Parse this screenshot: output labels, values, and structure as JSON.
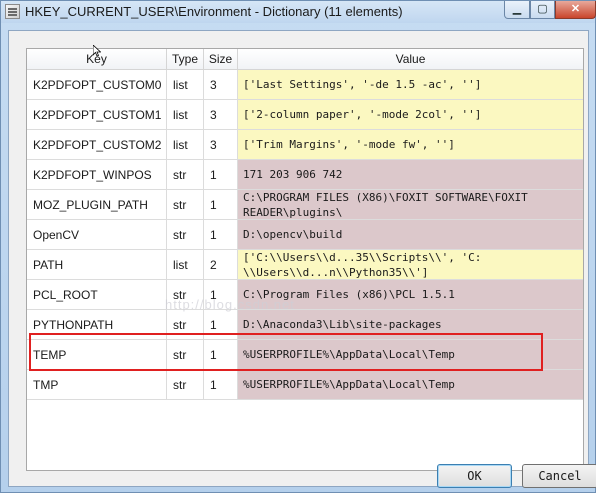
{
  "window": {
    "title": "HKEY_CURRENT_USER\\Environment - Dictionary (11 elements)",
    "minimize_glyph": "▁",
    "maximize_glyph": "▢",
    "close_glyph": "✕"
  },
  "table": {
    "columns": [
      "Key",
      "Type",
      "Size",
      "Value"
    ],
    "rows": [
      {
        "key": "K2PDFOPT_CUSTOM0",
        "type": "list",
        "size": "3",
        "value": "['Last Settings', '-de 1.5 -ac', '']"
      },
      {
        "key": "K2PDFOPT_CUSTOM1",
        "type": "list",
        "size": "3",
        "value": "['2-column paper', '-mode 2col', '']"
      },
      {
        "key": "K2PDFOPT_CUSTOM2",
        "type": "list",
        "size": "3",
        "value": "['Trim Margins', '-mode fw', '']"
      },
      {
        "key": "K2PDFOPT_WINPOS",
        "type": "str",
        "size": "1",
        "value": "171 203 906 742"
      },
      {
        "key": "MOZ_PLUGIN_PATH",
        "type": "str",
        "size": "1",
        "value": "C:\\PROGRAM FILES (X86)\\FOXIT SOFTWARE\\FOXIT\nREADER\\plugins\\"
      },
      {
        "key": "OpenCV",
        "type": "str",
        "size": "1",
        "value": "D:\\opencv\\build"
      },
      {
        "key": "PATH",
        "type": "list",
        "size": "2",
        "value": "['C:\\\\Users\\\\d...35\\\\Scripts\\\\', 'C:\n\\\\Users\\\\d...n\\\\Python35\\\\']"
      },
      {
        "key": "PCL_ROOT",
        "type": "str",
        "size": "1",
        "value": "C:\\Program Files (x86)\\PCL 1.5.1"
      },
      {
        "key": "PYTHONPATH",
        "type": "str",
        "size": "1",
        "value": "D:\\Anaconda3\\Lib\\site-packages"
      },
      {
        "key": "TEMP",
        "type": "str",
        "size": "1",
        "value": "%USERPROFILE%\\AppData\\Local\\Temp"
      },
      {
        "key": "TMP",
        "type": "str",
        "size": "1",
        "value": "%USERPROFILE%\\AppData\\Local\\Temp"
      }
    ]
  },
  "watermark": "http://blog.csdn.net",
  "buttons": {
    "ok": "OK",
    "cancel": "Cancel"
  },
  "colors": {
    "list_bg": "#fbf8c1",
    "str_bg": "#dcc8cb",
    "highlight": "#e02020"
  }
}
